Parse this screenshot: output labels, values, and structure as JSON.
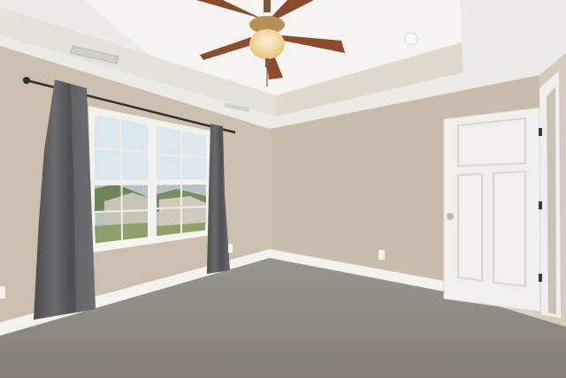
{
  "scene": {
    "description_free": true,
    "colors": {
      "ceiling": "#ecebe7",
      "tray": "#f4f3f0",
      "wall_left": "#cbbfae",
      "wall_back": "#c9bdac",
      "wall_right": "#d3c8b8",
      "carpet": "#8f8980",
      "trim": "#f3f2ef",
      "door": "#f1f0ed",
      "curtain": "#5d5d5e",
      "fan_blade": "#8a4a2c",
      "fan_light": "#f3d9a3",
      "sky": "#d9e3ea",
      "grass": "#8ea06c"
    }
  }
}
